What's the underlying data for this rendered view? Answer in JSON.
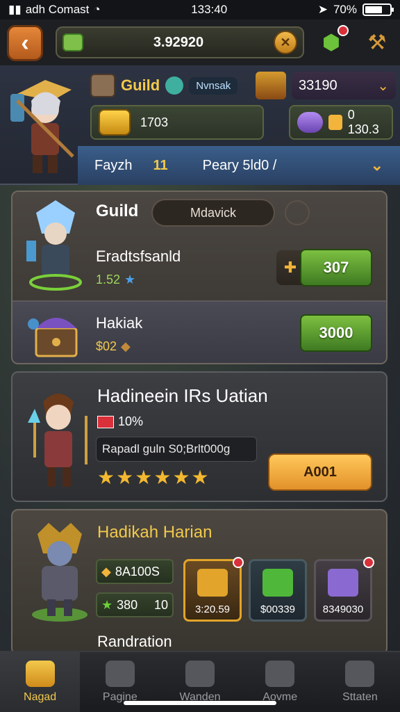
{
  "status_bar": {
    "carrier": "adh Comast",
    "time": "133:40",
    "battery": "70%",
    "battery_level": 0.7
  },
  "top_bar": {
    "back_icon": "chevron-left-icon",
    "currency_value": "3.92920",
    "currency_icon": "gem-icon",
    "close_icon": "x-icon",
    "rewards_icon": "green-gem-icon",
    "pickaxe_icon": "pickaxe-icon"
  },
  "hero_header": {
    "guild_label": "Guild",
    "guild_tag": "Nvnsak",
    "right_value": "33190",
    "coins_value": "1703",
    "key_value": "0 130.3",
    "faction_label": "Fayzh",
    "faction_level": "11",
    "player_name": "Peary 5ld0 /"
  },
  "guild_card": {
    "title": "Guild",
    "search_value": "Mdavick",
    "row1": {
      "name": "Eradtsfsanld",
      "sub_value": "1.52",
      "button_label": "307"
    },
    "row2": {
      "name": "Hakiak",
      "sub_value": "$02",
      "button_label": "3000"
    }
  },
  "event_card": {
    "title": "Hadineein IRs Uatian",
    "flag_value": "10%",
    "description": "Rapadl guln S0;Brlt000g",
    "stars": 6,
    "button_label": "A001"
  },
  "daily_card": {
    "title": "Hadikah Harian",
    "pill1": "8A100S",
    "pill2_value": "380",
    "pill2_extra": "10",
    "rewards": [
      {
        "label": "3:20.59",
        "icon": "gold-ingot-icon",
        "color": "#e2a42a"
      },
      {
        "label": "$00339",
        "icon": "green-gem-icon",
        "color": "#4fb83a"
      },
      {
        "label": "8349030",
        "icon": "chest-icon",
        "color": "#8a6ad0"
      }
    ],
    "subtitle": "Randration"
  },
  "bottom_nav": [
    {
      "label": "Nagad",
      "icon": "home-icon",
      "active": true
    },
    {
      "label": "Pagine",
      "icon": "search-icon",
      "active": false
    },
    {
      "label": "Wanden",
      "icon": "globe-icon",
      "active": false
    },
    {
      "label": "Aovme",
      "icon": "edit-icon",
      "active": false
    },
    {
      "label": "Sttaten",
      "icon": "gear-icon",
      "active": false
    }
  ]
}
